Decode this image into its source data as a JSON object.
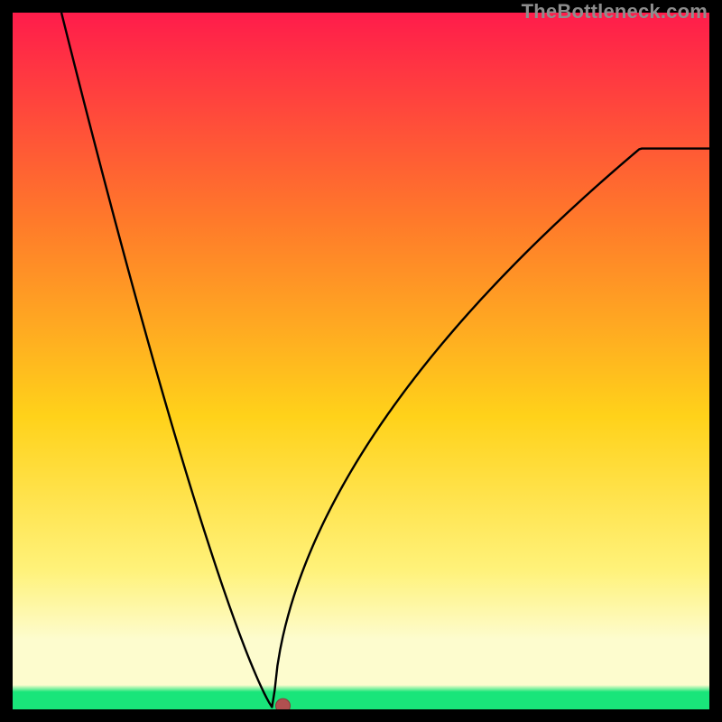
{
  "watermark": "TheBottleneck.com",
  "colors": {
    "top": "#ff1c4b",
    "upper_mid": "#ff7a2a",
    "mid": "#ffd21a",
    "lower_mid": "#fff27a",
    "pale_band": "#fdfcce",
    "green": "#19e57a",
    "curve": "#000000",
    "marker_fill": "#b05050",
    "marker_stroke": "#8a3a3a",
    "frame_bg": "#000000"
  },
  "chart_data": {
    "type": "line",
    "title": "",
    "xlabel": "",
    "ylabel": "",
    "xlim": [
      0,
      1
    ],
    "ylim": [
      0,
      1
    ],
    "curve": {
      "minimum_x": 0.375,
      "left_start": {
        "x": 0.07,
        "y": 1.0
      },
      "right_end": {
        "x": 1.0,
        "y": 0.805
      },
      "left_exponent": 1.22,
      "right_exponent": 0.55,
      "right_scale": 1.1
    },
    "marker": {
      "x": 0.388,
      "y": 0.005,
      "r": 8
    },
    "gradient_bands": [
      {
        "y": 0.0,
        "color_key": "top"
      },
      {
        "y": 0.3,
        "color_key": "upper_mid"
      },
      {
        "y": 0.58,
        "color_key": "mid"
      },
      {
        "y": 0.8,
        "color_key": "lower_mid"
      },
      {
        "y": 0.9,
        "color_key": "pale_band"
      },
      {
        "y": 0.965,
        "color_key": "pale_band"
      },
      {
        "y": 0.975,
        "color_key": "green"
      },
      {
        "y": 1.0,
        "color_key": "green"
      }
    ]
  }
}
